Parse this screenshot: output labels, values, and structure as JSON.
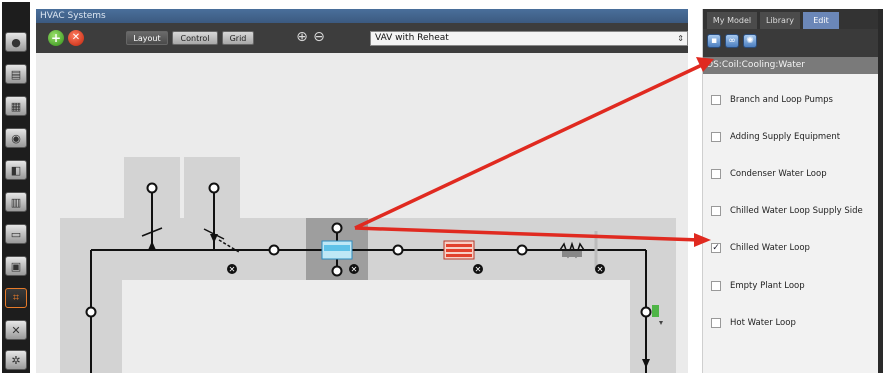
{
  "window": {
    "title": "HVAC Systems"
  },
  "toolbar": {
    "add_icon": "plus-icon",
    "remove_icon": "close-icon",
    "buttons": [
      {
        "label": "Layout",
        "active": true
      },
      {
        "label": "Control",
        "active": false
      },
      {
        "label": "Grid",
        "active": false
      }
    ],
    "zoom_in_icon": "zoom-in-icon",
    "zoom_out_icon": "zoom-out-icon",
    "system_select": {
      "value": "VAV with Reheat"
    }
  },
  "left_toolbar": {
    "icons": [
      "sphere-icon",
      "schedules-icon",
      "constructions-icon",
      "loads-icon",
      "space-types-icon",
      "facility-icon",
      "zones-icon",
      "building-story-icon",
      "hvac-systems-icon",
      "measures-icon",
      "settings-icon"
    ],
    "active_index": 8
  },
  "right_pane": {
    "tabs": [
      {
        "label": "My Model",
        "active": false
      },
      {
        "label": "Library",
        "active": false
      },
      {
        "label": "Edit",
        "active": true
      }
    ],
    "edit_icons": [
      "inspector-icon",
      "connections-icon",
      "controls-icon"
    ],
    "object_title": "OS:Coil:Cooling:Water",
    "loops": [
      {
        "label": "Branch and Loop Pumps",
        "checked": false
      },
      {
        "label": "Adding Supply Equipment",
        "checked": false
      },
      {
        "label": "Condenser Water Loop",
        "checked": false
      },
      {
        "label": "Chilled Water Loop Supply Side",
        "checked": false
      },
      {
        "label": "Chilled Water Loop",
        "checked": true
      },
      {
        "label": "Empty Plant Loop",
        "checked": false
      },
      {
        "label": "Hot Water Loop",
        "checked": false
      }
    ]
  },
  "colors": {
    "annotation_arrow": "#e02a20",
    "selected_tab": "#6b87b8",
    "canvas": "#ebebeb",
    "loop_band": "#d3d3d3"
  }
}
